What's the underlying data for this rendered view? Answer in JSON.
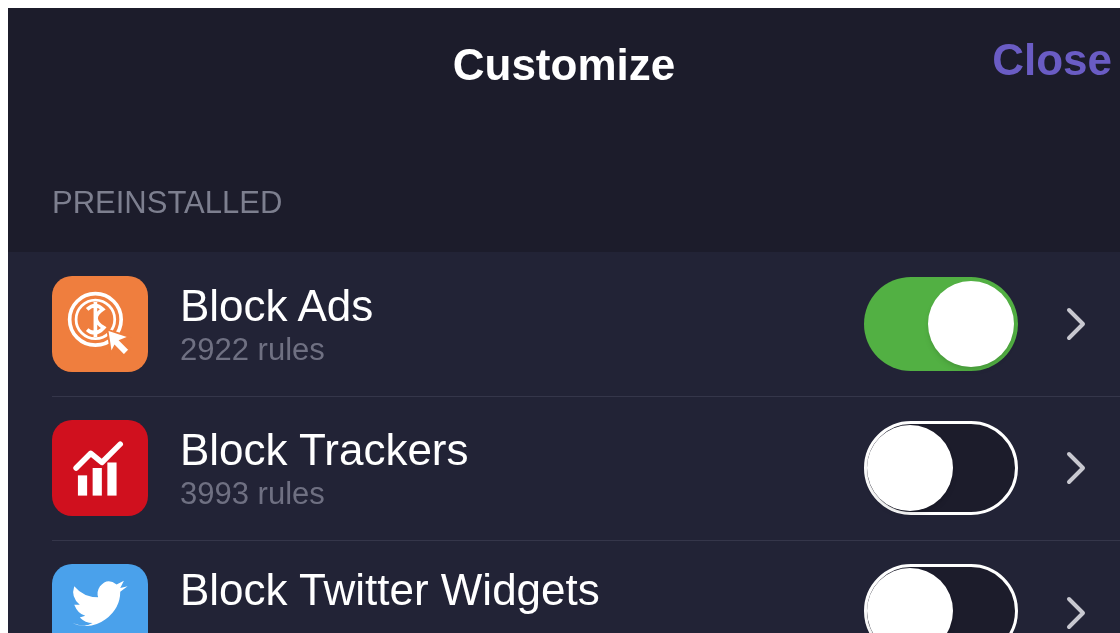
{
  "nav_bar": {
    "title": "Customize",
    "close": "Close"
  },
  "section": {
    "header": "PREINSTALLED"
  },
  "items": [
    {
      "kind": "ads",
      "title": "Block Ads",
      "subtitle": "2922 rules",
      "on": true
    },
    {
      "kind": "trackers",
      "title": "Block Trackers",
      "subtitle": "3993 rules",
      "on": false
    },
    {
      "kind": "twitter",
      "title": "Block Twitter Widgets",
      "on": false
    }
  ]
}
